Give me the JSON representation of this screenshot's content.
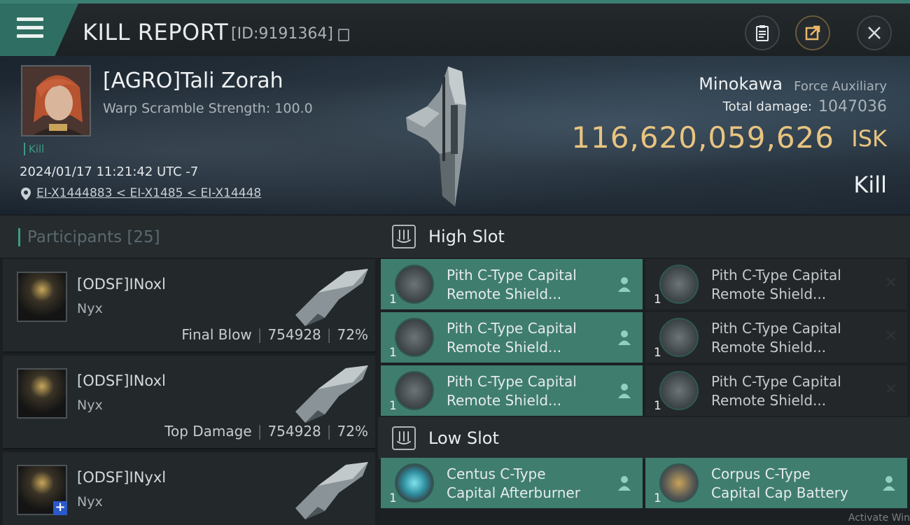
{
  "header": {
    "title": "KILL REPORT",
    "report_id": "[ID:9191364]"
  },
  "victim": {
    "name": "[AGRO]Tali Zorah",
    "warp_scramble": "Warp Scramble Strength: 100.0",
    "tag": "Kill",
    "timestamp": "2024/01/17 11:21:42 UTC -7",
    "location": "EI-X1444883 < EI-X1485 < EI-X14448"
  },
  "ship": {
    "name": "Minokawa",
    "class": "Force Auxiliary",
    "damage_label": "Total damage:",
    "damage_value": "1047036",
    "isk_value": "116,620,059,626",
    "isk_unit": "ISK",
    "result": "Kill"
  },
  "participants": {
    "label": "Participants",
    "count": "[25]",
    "rows": [
      {
        "name": "[ODSF]INoxl",
        "ship": "Nyx",
        "role": "Final Blow",
        "damage": "754928",
        "percent": "72%"
      },
      {
        "name": "[ODSF]INoxl",
        "ship": "Nyx",
        "role": "Top Damage",
        "damage": "754928",
        "percent": "72%"
      },
      {
        "name": "[ODSF]INyxl",
        "ship": "Nyx"
      }
    ]
  },
  "slots": {
    "high_label": "High Slot",
    "low_label": "Low Slot",
    "high": [
      {
        "line1": "Pith C-Type Capital",
        "line2": "Remote Shield...",
        "qty": "1"
      },
      {
        "line1": "Pith C-Type Capital",
        "line2": "Remote Shield...",
        "qty": "1"
      },
      {
        "line1": "Pith C-Type Capital",
        "line2": "Remote Shield...",
        "qty": "1"
      },
      {
        "line1": "Pith C-Type Capital",
        "line2": "Remote Shield...",
        "qty": "1"
      },
      {
        "line1": "Pith C-Type Capital",
        "line2": "Remote Shield...",
        "qty": "1"
      },
      {
        "line1": "Pith C-Type Capital",
        "line2": "Remote Shield...",
        "qty": "1"
      }
    ],
    "low": [
      {
        "line1": "Centus C-Type",
        "line2": "Capital Afterburner",
        "qty": "1"
      },
      {
        "line1": "Corpus C-Type",
        "line2": "Capital Cap Battery",
        "qty": "1"
      }
    ]
  },
  "watermark": "Activate Win"
}
